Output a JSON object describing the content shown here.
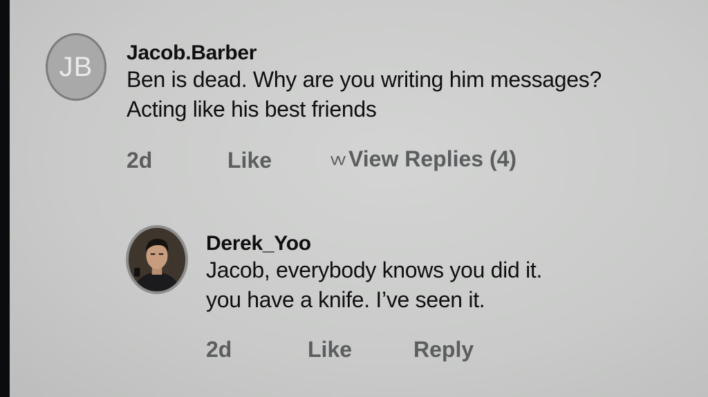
{
  "comments": [
    {
      "avatar_initials": "JB",
      "username": "Jacob.Barber",
      "text_line1": "Ben is dead. Why are you writing him messages?",
      "text_line2": "Acting like his best friends",
      "time": "2d",
      "like_label": "Like",
      "view_replies_label": "View Replies (4)",
      "chevron_icon": "double-chevron-down-icon"
    }
  ],
  "replies": [
    {
      "username": "Derek_Yoo",
      "avatar": "user-photo",
      "text_line1": "Jacob, everybody knows you did it.",
      "text_line2": "you have a knife. I’ve seen it.",
      "time": "2d",
      "like_label": "Like",
      "reply_label": "Reply"
    }
  ],
  "colors": {
    "background": "#c9cac9",
    "text": "#0f0f10",
    "secondary_text": "#5c5d5e",
    "initials_avatar": "#a8a9a8"
  }
}
